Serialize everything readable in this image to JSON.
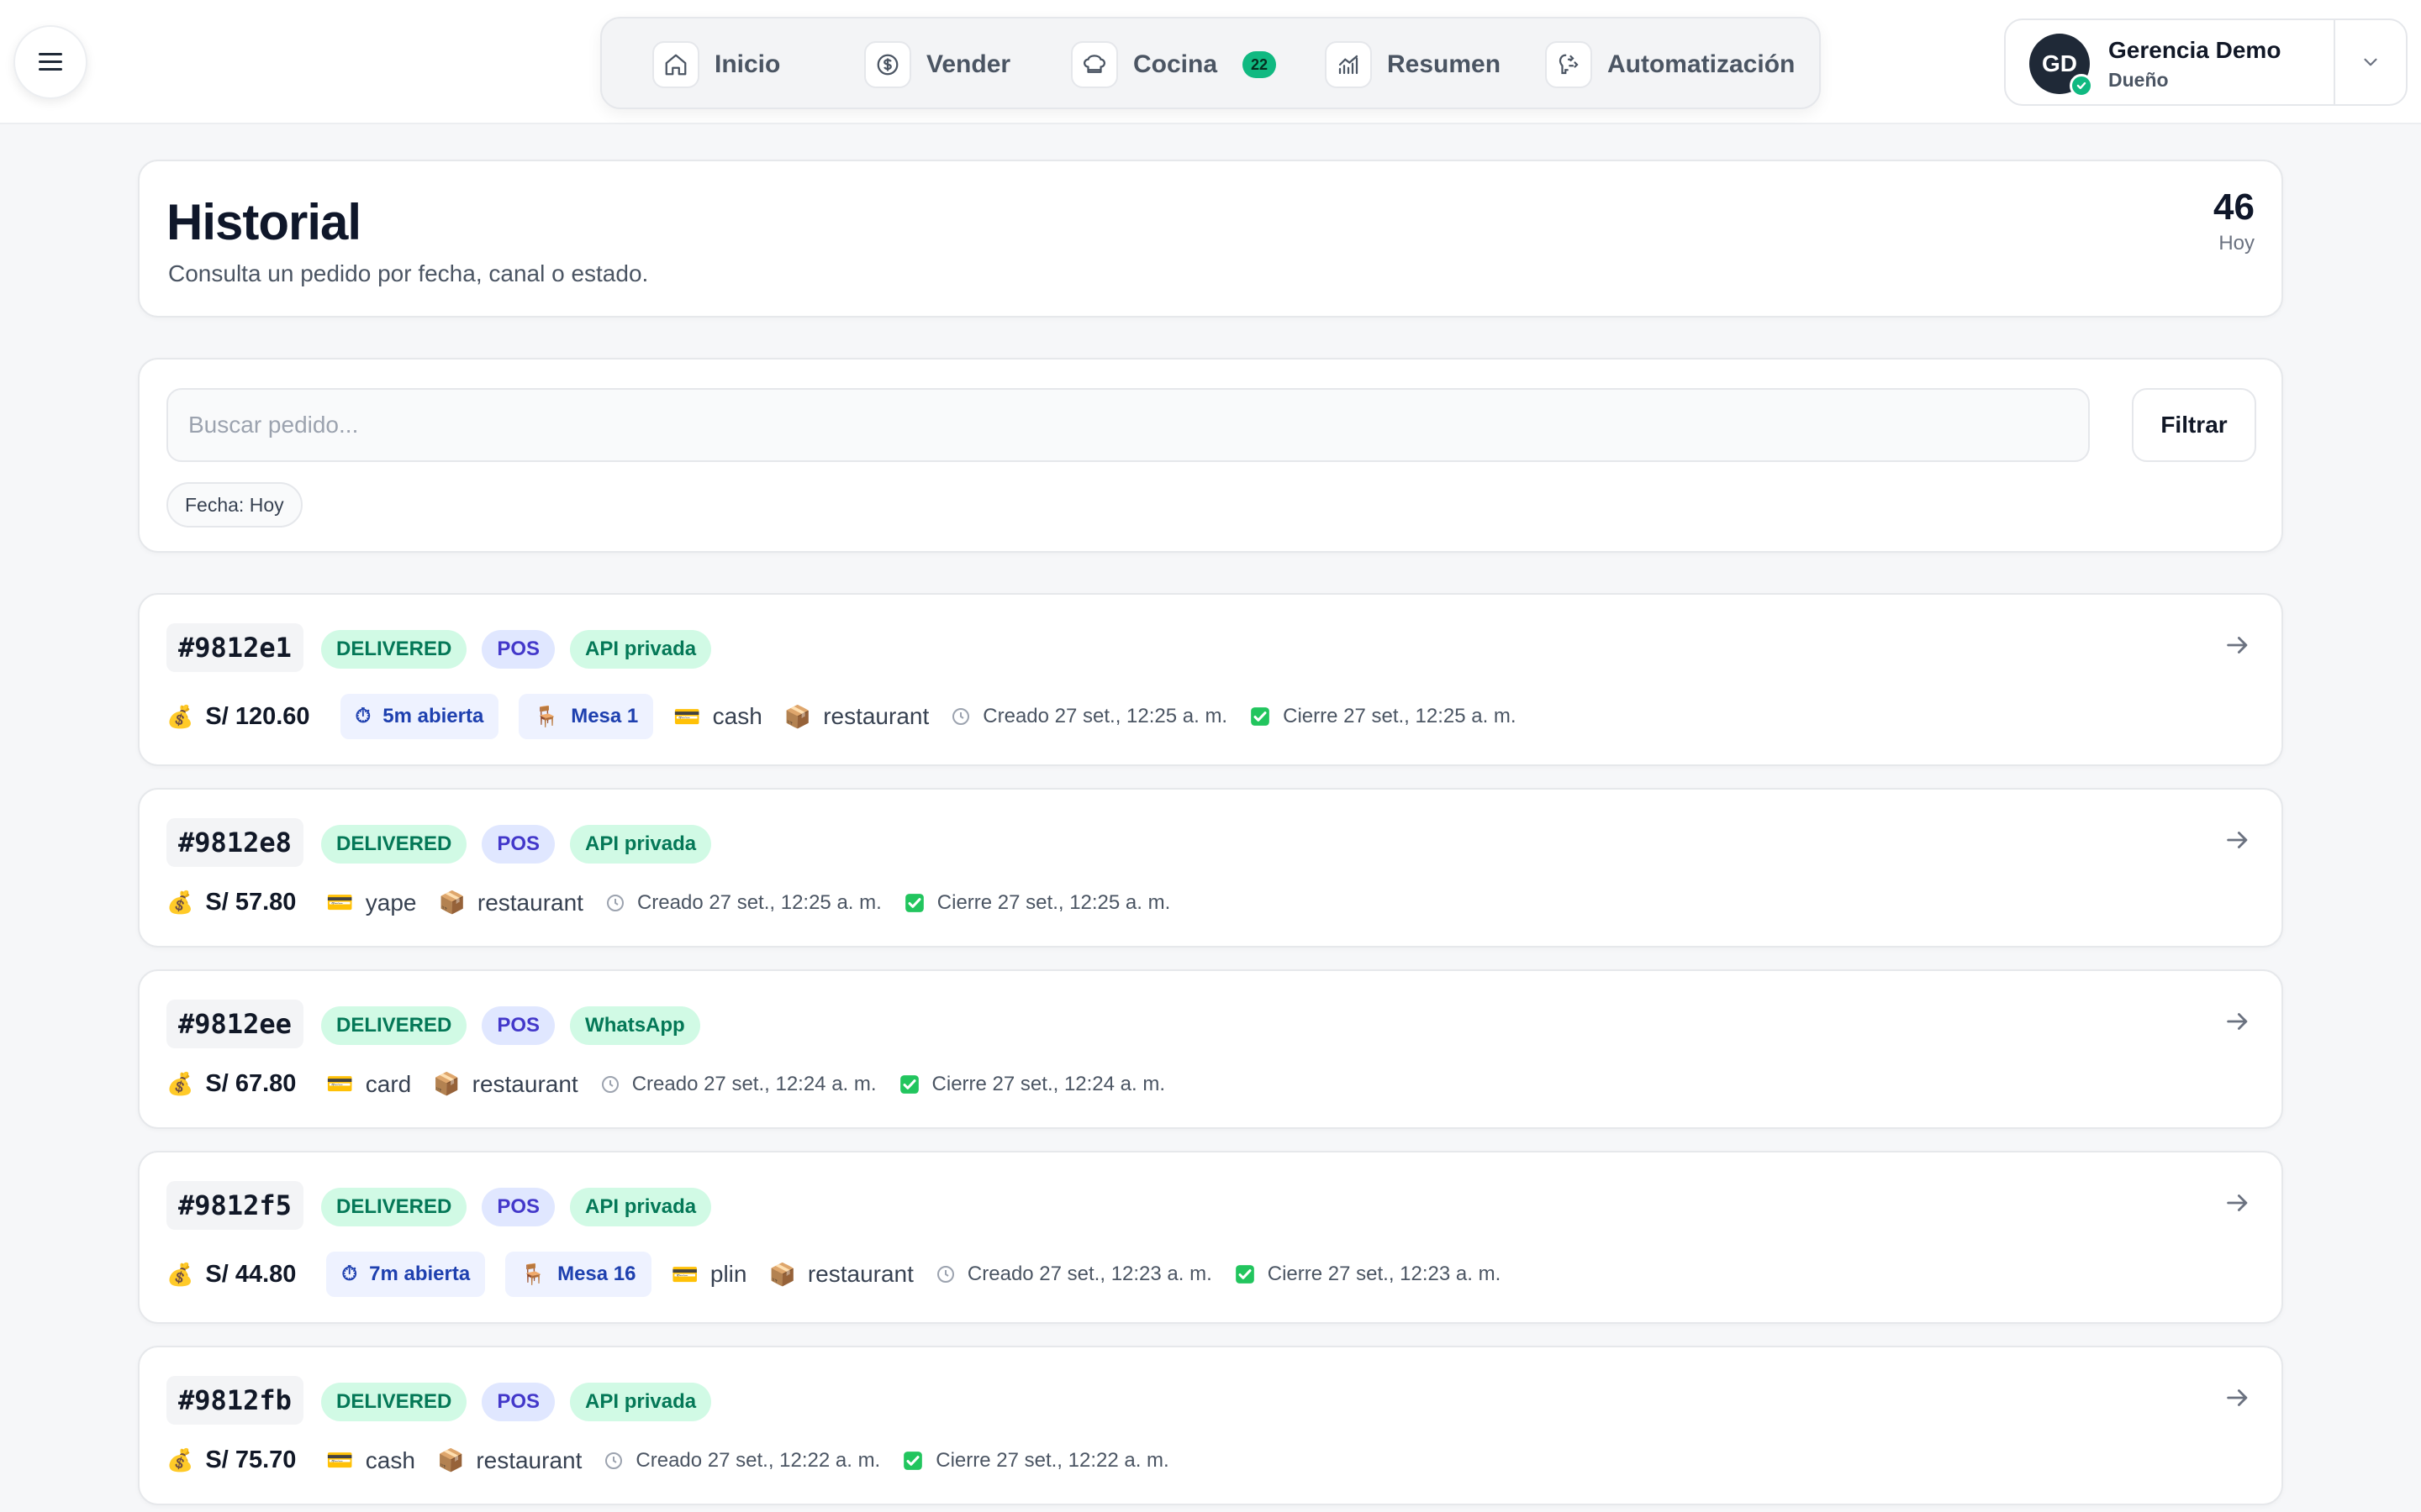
{
  "app": {
    "nav": [
      {
        "id": "inicio",
        "label": "Inicio",
        "icon": "home-icon"
      },
      {
        "id": "vender",
        "label": "Vender",
        "icon": "dollar-icon"
      },
      {
        "id": "cocina",
        "label": "Cocina",
        "icon": "chef-hat-icon",
        "badge": "22"
      },
      {
        "id": "resumen",
        "label": "Resumen",
        "icon": "chart-icon"
      },
      {
        "id": "automatizacion",
        "label": "Automatización",
        "icon": "automation-icon"
      }
    ],
    "user": {
      "initials": "GD",
      "name": "Gerencia Demo",
      "role": "Dueño"
    }
  },
  "header": {
    "title": "Historial",
    "subtitle": "Consulta un pedido por fecha, canal o estado.",
    "count": "46",
    "count_label": "Hoy"
  },
  "filters": {
    "search_placeholder": "Buscar pedido...",
    "filter_button": "Filtrar",
    "chip": "Fecha: Hoy"
  },
  "orders": [
    {
      "id": "#9812e1",
      "status": "DELIVERED",
      "source": "POS",
      "channel": "API privada",
      "amount": "S/ 120.60",
      "open_time": "5m abierta",
      "table": "Mesa 1",
      "payment": "cash",
      "type": "restaurant",
      "created": "Creado 27 set., 12:25 a. m.",
      "closed": "Cierre 27 set., 12:25 a. m."
    },
    {
      "id": "#9812e8",
      "status": "DELIVERED",
      "source": "POS",
      "channel": "API privada",
      "amount": "S/ 57.80",
      "payment": "yape",
      "type": "restaurant",
      "created": "Creado 27 set., 12:25 a. m.",
      "closed": "Cierre 27 set., 12:25 a. m."
    },
    {
      "id": "#9812ee",
      "status": "DELIVERED",
      "source": "POS",
      "channel": "WhatsApp",
      "amount": "S/ 67.80",
      "payment": "card",
      "type": "restaurant",
      "created": "Creado 27 set., 12:24 a. m.",
      "closed": "Cierre 27 set., 12:24 a. m."
    },
    {
      "id": "#9812f5",
      "status": "DELIVERED",
      "source": "POS",
      "channel": "API privada",
      "amount": "S/ 44.80",
      "open_time": "7m abierta",
      "table": "Mesa 16",
      "payment": "plin",
      "type": "restaurant",
      "created": "Creado 27 set., 12:23 a. m.",
      "closed": "Cierre 27 set., 12:23 a. m."
    },
    {
      "id": "#9812fb",
      "status": "DELIVERED",
      "source": "POS",
      "channel": "API privada",
      "amount": "S/ 75.70",
      "payment": "cash",
      "type": "restaurant",
      "created": "Creado 27 set., 12:22 a. m.",
      "closed": "Cierre 27 set., 12:22 a. m."
    }
  ],
  "colors": {
    "accent": "#10b981",
    "status_bg": "#d1fae5",
    "status_text": "#047857",
    "pos_bg": "#e0e7ff",
    "pos_text": "#4338ca"
  }
}
